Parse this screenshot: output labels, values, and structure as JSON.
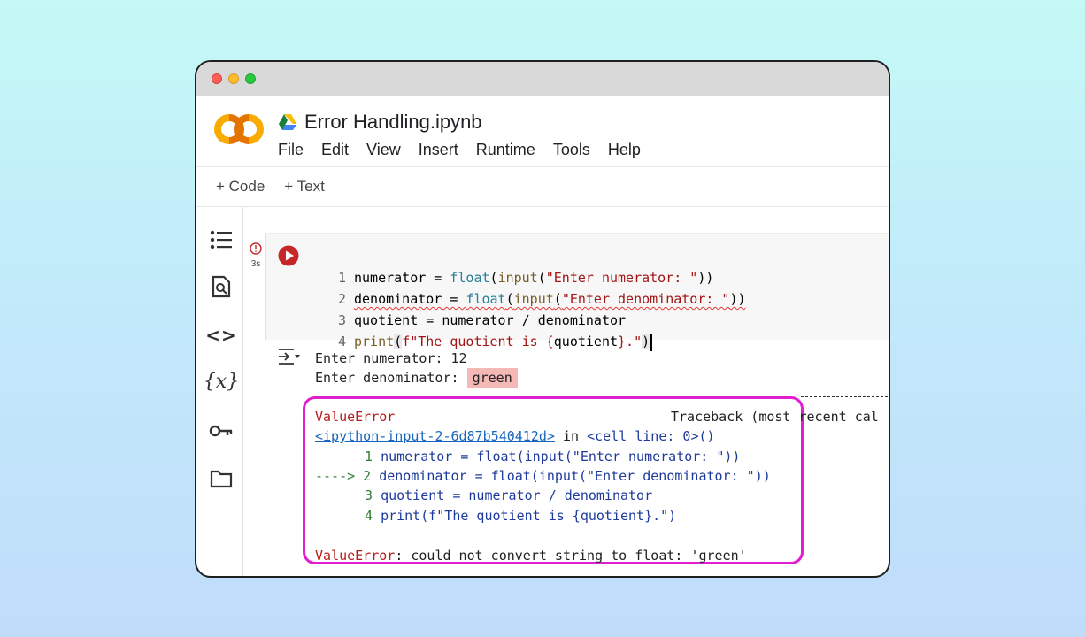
{
  "window": {
    "doc_title": "Error Handling.ipynb",
    "menu": [
      "File",
      "Edit",
      "View",
      "Insert",
      "Runtime",
      "Tools",
      "Help"
    ],
    "toolbar": {
      "add_code": "+ Code",
      "add_text": "+ Text"
    }
  },
  "sidebar": {
    "icons": [
      "table-of-contents-icon",
      "find-icon",
      "code-snippets-icon",
      "variables-icon",
      "secrets-key-icon",
      "files-folder-icon"
    ],
    "variables_glyph": "{x}",
    "code_glyph": "<>"
  },
  "cell": {
    "status_time": "3s",
    "lines": {
      "n1": "1",
      "n2": "2",
      "n3": "3",
      "n4": "4",
      "l1_a": "numerator = ",
      "l1_b": "float",
      "l1_c": "(",
      "l1_d": "input",
      "l1_e": "(",
      "l1_f": "\"Enter numerator: \"",
      "l1_g": "))",
      "l2_a": "denominator",
      "l2_b": " = ",
      "l2_c": "float",
      "l2_d": "(",
      "l2_e": "input",
      "l2_f": "(",
      "l2_g": "\"Enter denominator: \"",
      "l2_h": "))",
      "l3": "quotient = numerator / denominator",
      "l4_a": "print",
      "l4_b": "(",
      "l4_c": "f\"The quotient is {",
      "l4_d": "quotient",
      "l4_e": "}.\"",
      "l4_f": ")"
    }
  },
  "output": {
    "line1_label": "Enter numerator: ",
    "line1_value": "12",
    "line2_label": "Enter denominator: ",
    "line2_value": "green",
    "traceback": {
      "error_name": "ValueError",
      "header_right": "Traceback (most recent cal",
      "input_link": "<ipython-input-2-6d87b540412d>",
      "in_text": " in ",
      "cell_line": "<cell line: 0>()",
      "arrow": "---->",
      "n1": "1",
      "n2": "2",
      "n3": "3",
      "n4": "4",
      "t1": "numerator = float(input(\"Enter numerator: \"))",
      "t2_a": "denominator = float(input(",
      "t2_b": "\"Enter denominator: \"",
      "t2_c": "))",
      "t3": "quotient = numerator / denominator",
      "t4_a": "print(f\"The quotient is {quotient}.\")",
      "final_name": "ValueError",
      "final_msg": ": could not convert string to float: 'green'"
    }
  },
  "colors": {
    "frame": "#1f1f1f",
    "highlight_box": "#e020d0",
    "run_button": "#c62828",
    "input_highlight": "#f4b8b6"
  }
}
